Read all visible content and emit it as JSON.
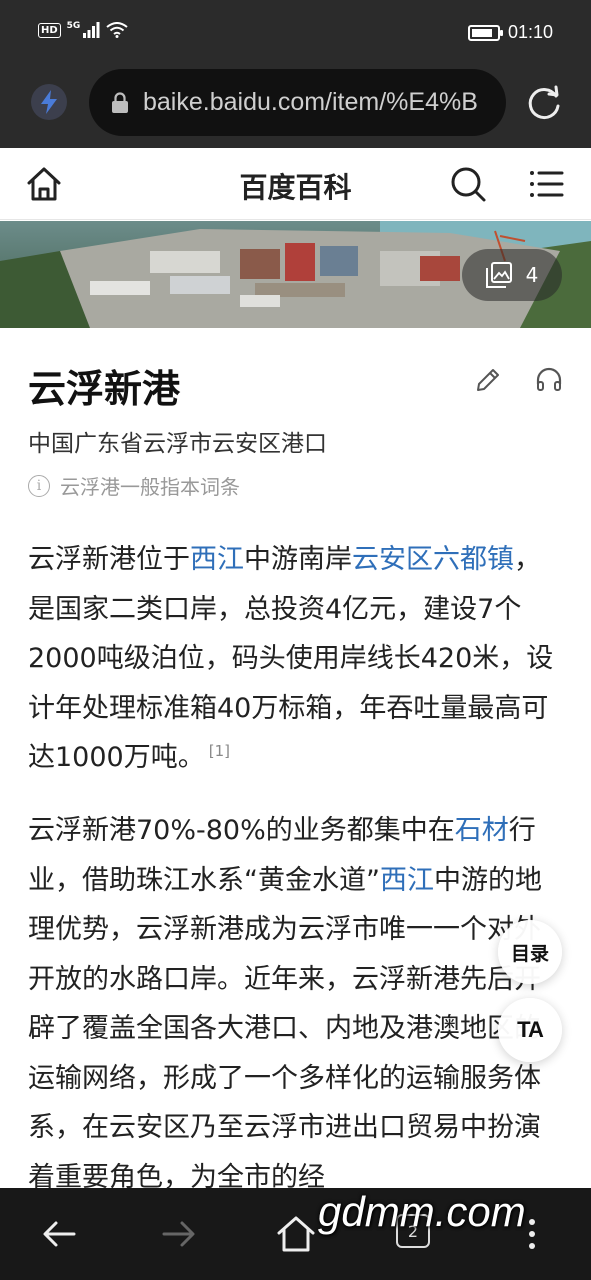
{
  "status_bar": {
    "hd_label": "HD",
    "signal_label": "5G",
    "time": "01:10"
  },
  "browser": {
    "url": "baike.baidu.com/item/%E4%B",
    "icons": [
      "lightning-icon",
      "lock-icon",
      "reload-icon"
    ]
  },
  "site": {
    "title": "百度百科"
  },
  "banner": {
    "album_count": "4"
  },
  "lemma": {
    "title": "云浮新港",
    "description": "中国广东省云浮市云安区港口",
    "note": "云浮港一般指本词条"
  },
  "paragraph1": {
    "t1": "云浮新港位于",
    "l1": "西江",
    "t2": "中游南岸",
    "l2": "云安区六都镇",
    "t3": "，是国家二类口岸，总投资4亿元，建设7个2000吨级泊位，码头使用岸线长420米，设计年处理标准箱40万标箱，年吞吐量最高可达1000万吨。",
    "ref": "[1]"
  },
  "paragraph2": {
    "t1": "云浮新港70%-80%的业务都集中在",
    "l1": "石材",
    "t2": "行业，借助珠江水系“黄金水道”",
    "l2": "西江",
    "t3": "中游的地理优势，云浮新港成为云浮市唯一一个对外开放的水路口岸。近年来，云浮新港先后开辟了覆盖全国各大港口、内地及港澳地区的运输网络，形成了一个多样化的运输服务体系，在云安区乃至云浮市进出口贸易中扮演着重要角色，为全市的经"
  },
  "floating": {
    "toc_label": "目录",
    "ta_label": "TA"
  },
  "watermark": "gdmm.com",
  "nav": {
    "tab_count": "2"
  }
}
